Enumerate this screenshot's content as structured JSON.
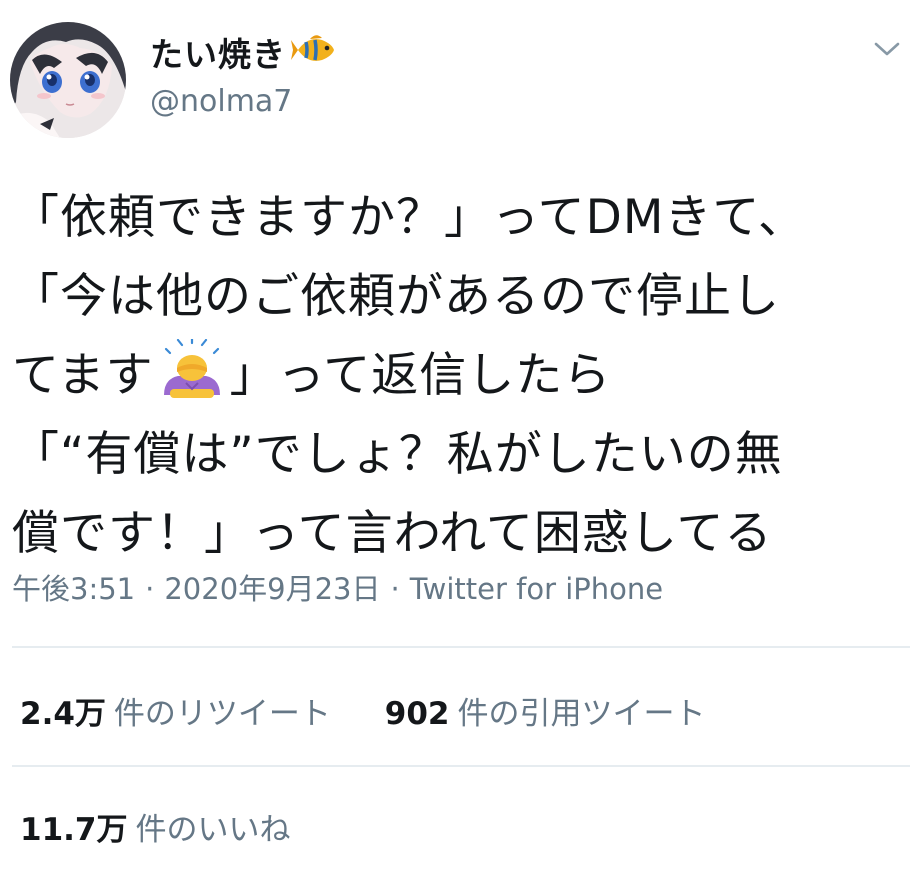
{
  "author": {
    "display_name": "たい焼き",
    "name_emoji": "fish-icon",
    "handle": "@nolma7"
  },
  "tweet": {
    "lines": [
      "「依頼できますか？」ってDMきて、",
      "「今は他のご依頼があるので停止し",
      "てます",
      "」って返信したら",
      "「“有償は”でしょ？私がしたいの無",
      "償です！」って言われて困惑してる"
    ],
    "inline_emoji": "person-bowing-emoji"
  },
  "meta": {
    "time": "午後3:51",
    "separator": "·",
    "date": "2020年9月23日",
    "source": "Twitter for iPhone"
  },
  "stats": {
    "retweets": {
      "count": "2.4万",
      "label": "件のリツイート"
    },
    "quotes": {
      "count": "902",
      "label": "件の引用ツイート"
    },
    "likes": {
      "count": "11.7万",
      "label": "件のいいね"
    }
  },
  "colors": {
    "text": "#14171a",
    "secondary": "#657786",
    "divider": "#e6ecf0"
  }
}
